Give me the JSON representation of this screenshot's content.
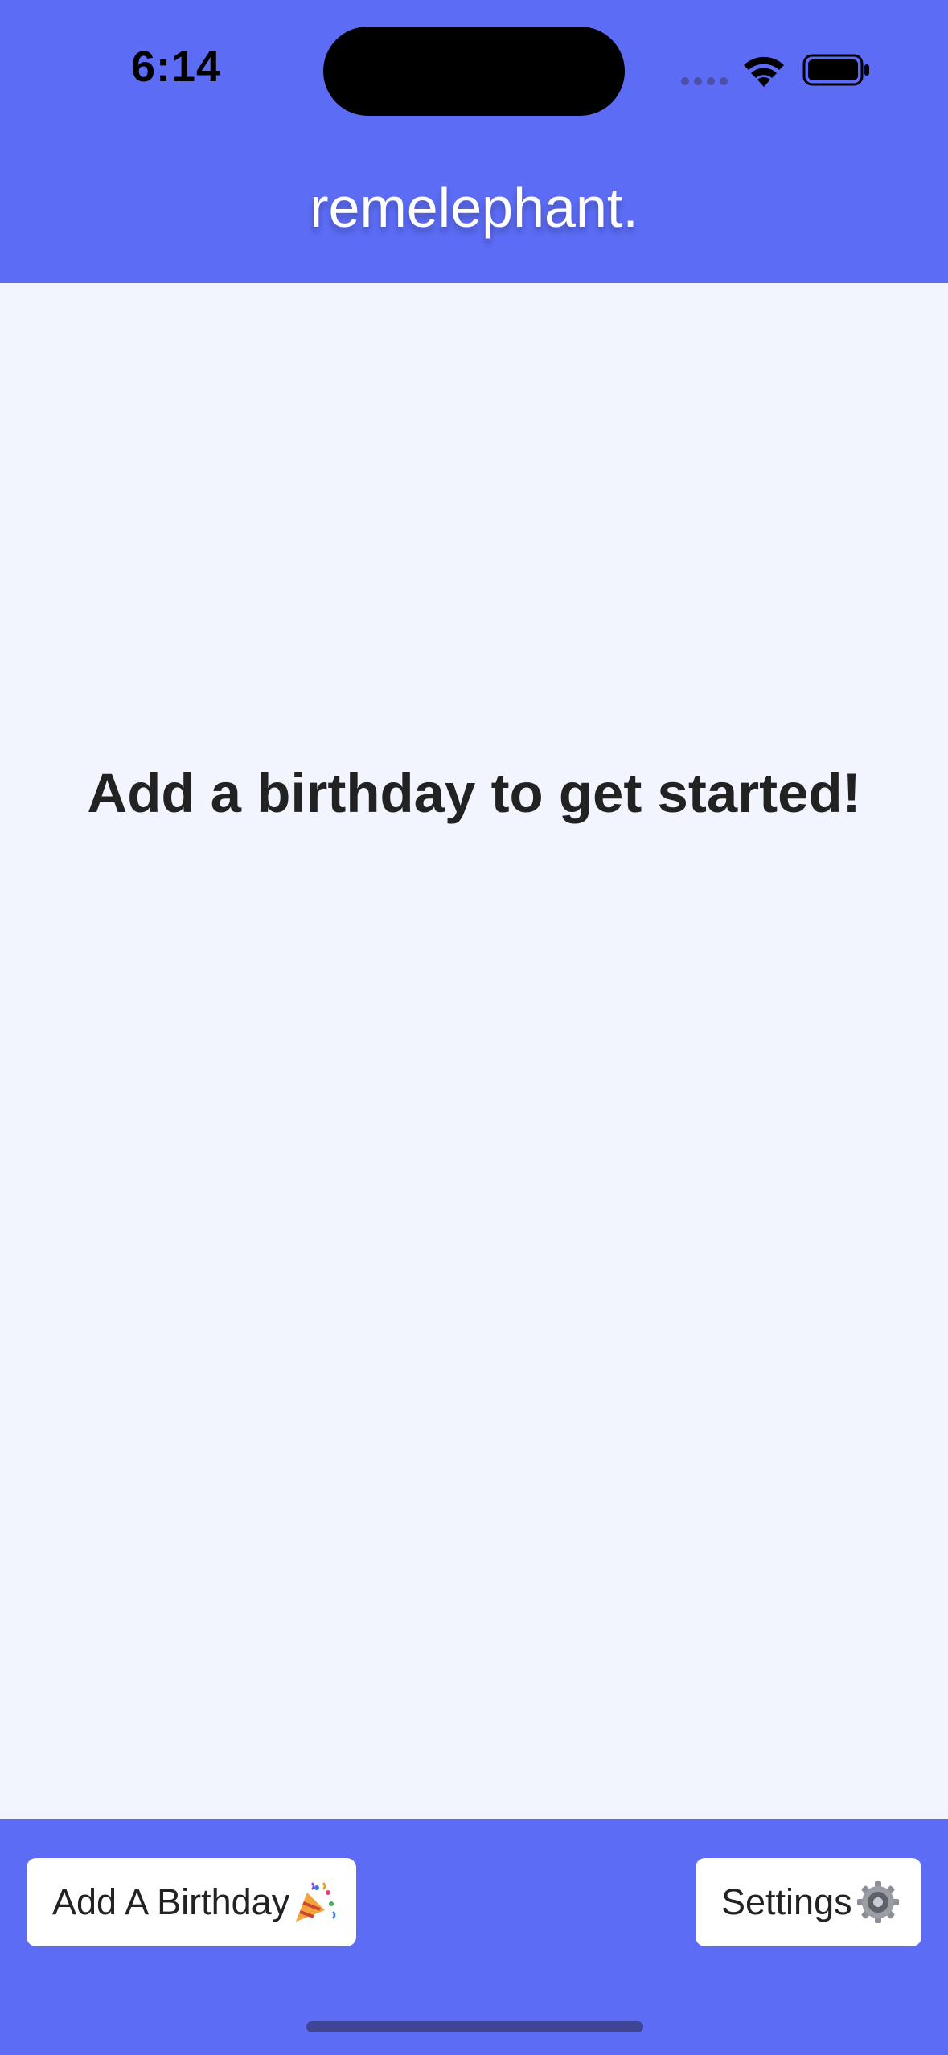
{
  "status_bar": {
    "time": "6:14"
  },
  "header": {
    "title": "remelephant."
  },
  "main": {
    "empty_message": "Add a birthday to get started!"
  },
  "footer": {
    "add_birthday_label": "Add A Birthday",
    "add_birthday_icon": "party-popper-icon",
    "settings_label": "Settings",
    "settings_icon": "gear-icon"
  },
  "colors": {
    "brand": "#5c6cf5",
    "background": "#f2f5fd",
    "text": "#222222",
    "button_bg": "#ffffff"
  }
}
